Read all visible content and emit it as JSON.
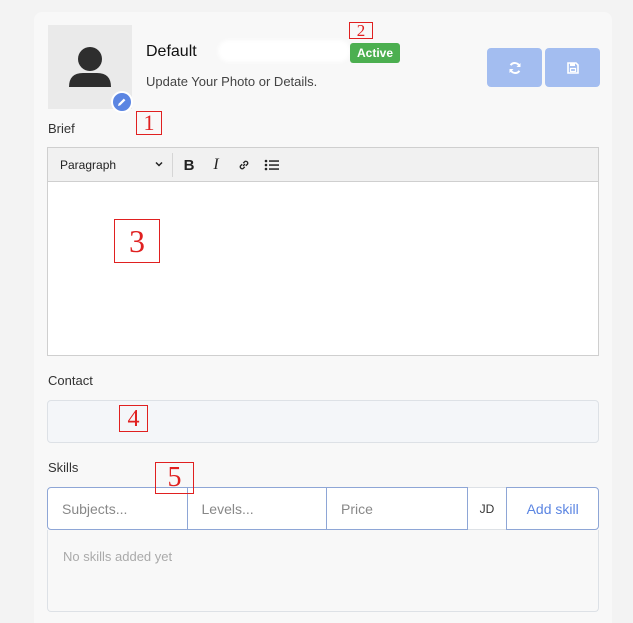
{
  "profile": {
    "name": "Default",
    "status_badge": "Active",
    "subtitle": "Update Your Photo or Details."
  },
  "colors": {
    "accent": "#5b85e2",
    "active_badge": "#4caf50",
    "button_disabled": "#a3bdf0",
    "annotation": "#e02020"
  },
  "icons": {
    "avatar": "user-silhouette-icon",
    "edit": "pencil-icon",
    "refresh": "refresh-icon",
    "save": "floppy-disk-icon",
    "block_select": "chevron-down-icon",
    "link": "link-icon",
    "list": "bulleted-list-icon"
  },
  "brief": {
    "label": "Brief",
    "toolbar": {
      "block_format": "Paragraph",
      "bold": "B",
      "italic": "I"
    },
    "content": ""
  },
  "contact": {
    "label": "Contact",
    "value": ""
  },
  "skills": {
    "label": "Skills",
    "subjects_placeholder": "Subjects...",
    "levels_placeholder": "Levels...",
    "price_placeholder": "Price",
    "currency": "JD",
    "add_button": "Add skill",
    "empty_message": "No skills added yet"
  },
  "annotations": [
    "1",
    "2",
    "3",
    "4",
    "5"
  ]
}
